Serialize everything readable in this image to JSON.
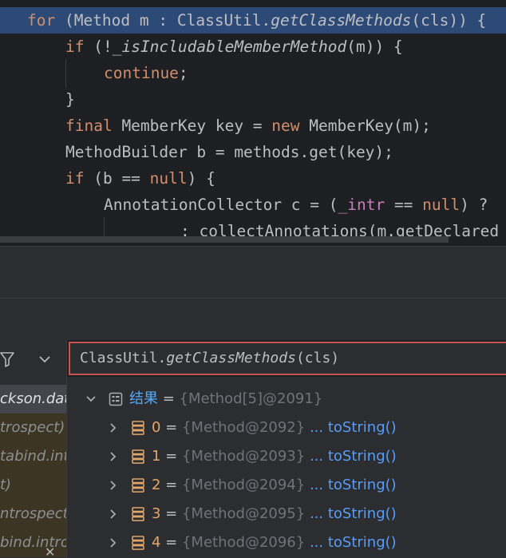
{
  "code": {
    "line1": {
      "kw": "for",
      "a": " (Method m : ClassUtil.",
      "fn": "getClassMethods",
      "b": "(cls)) {"
    },
    "line2": {
      "kw": "if",
      "a": " (!",
      "fn": "_isIncludableMemberMethod",
      "b": "(m)) {"
    },
    "line3": {
      "kw": "continue",
      "b": ";"
    },
    "line4": {
      "b": "}"
    },
    "line5": {
      "kw": "final",
      "a": " MemberKey key = ",
      "kw2": "new",
      "b": " MemberKey(m);"
    },
    "line6": {
      "a": "MethodBuilder b = methods.get(key);"
    },
    "line7": {
      "kw": "if",
      "a": " (b == ",
      "kw2": "null",
      "b": ") {"
    },
    "line8": {
      "a": "AnnotationCollector c = (",
      "fld": "_intr",
      "b": " == ",
      "kw2": "null",
      "c": ") ?"
    },
    "line9": {
      "a": ": collectAnnotations(m.getDeclared"
    }
  },
  "frames": {
    "items": [
      {
        "label": "ckson.data"
      },
      {
        "label": "trospect)"
      },
      {
        "label": "tabind.int"
      },
      {
        "label": "t)"
      },
      {
        "label": "ntrospect)"
      },
      {
        "label": "bind.intros"
      }
    ]
  },
  "expression": {
    "prefix": "ClassUtil.",
    "method": "getClassMethods",
    "suffix": "(cls)"
  },
  "variables": {
    "root": {
      "name": "结果",
      "eq": " = ",
      "value": "{Method[5]@2091}"
    },
    "children": [
      {
        "name": "0",
        "eq": " = ",
        "value": "{Method@2092}",
        "link": "... toString()"
      },
      {
        "name": "1",
        "eq": " = ",
        "value": "{Method@2093}",
        "link": "... toString()"
      },
      {
        "name": "2",
        "eq": " = ",
        "value": "{Method@2094}",
        "link": "... toString()"
      },
      {
        "name": "3",
        "eq": " = ",
        "value": "{Method@2095}",
        "link": "... toString()"
      },
      {
        "name": "4",
        "eq": " = ",
        "value": "{Method@2096}",
        "link": "... toString()"
      }
    ]
  },
  "colors": {
    "accent": "#2d4a77",
    "error_border": "#c75450",
    "link": "#589df6",
    "keyword": "#cf8e6d"
  }
}
